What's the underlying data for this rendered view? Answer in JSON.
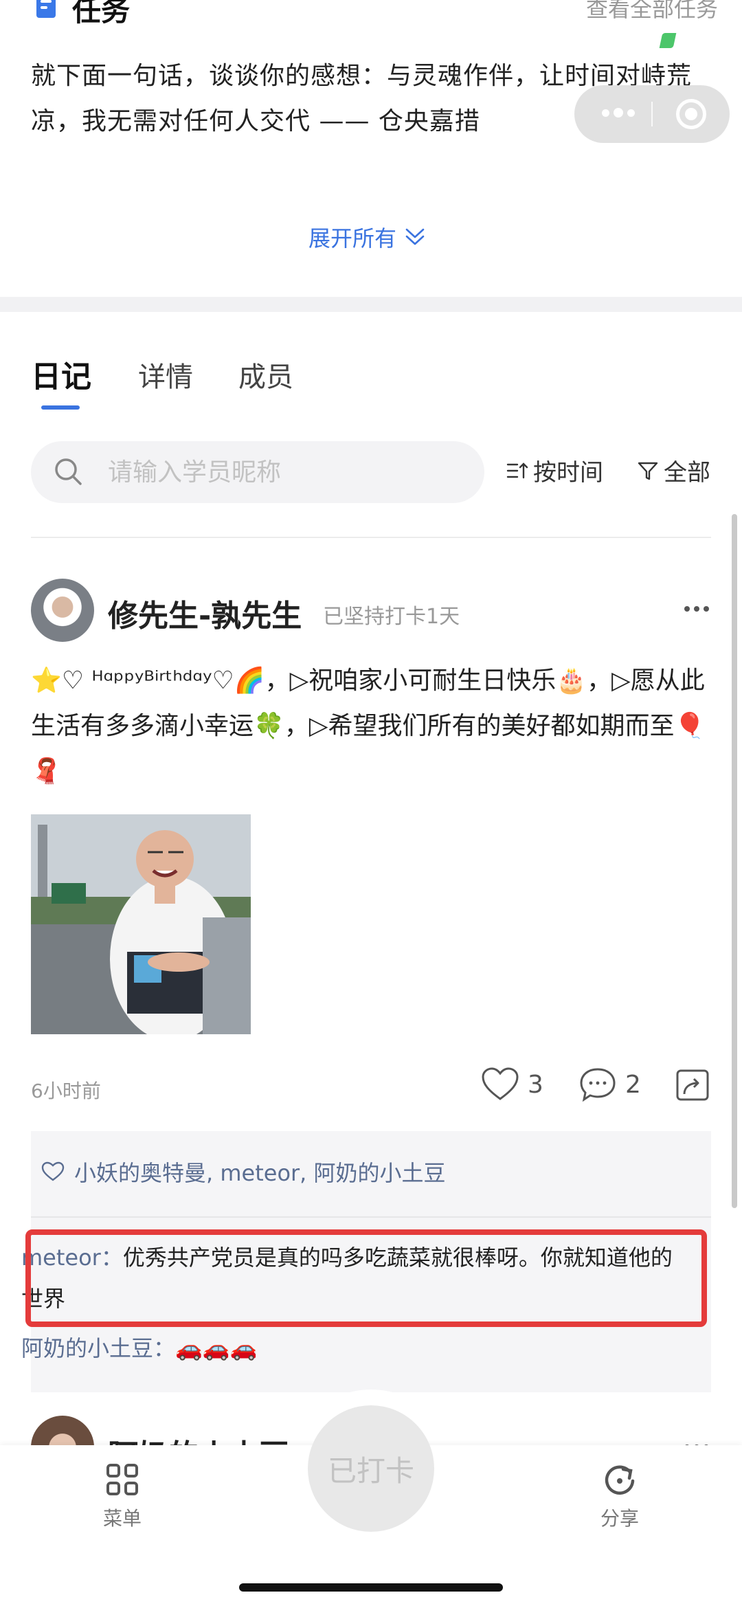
{
  "task_section": {
    "title": "任务",
    "view_all": "查看全部任务",
    "text": "就下面一句话，谈谈你的感想：与灵魂作伴，让时间对峙荒凉，我无需对任何人交代 —— 仓央嘉措",
    "expand_label": "展开所有"
  },
  "tabs": [
    {
      "label": "日记",
      "active": true
    },
    {
      "label": "详情",
      "active": false
    },
    {
      "label": "成员",
      "active": false
    }
  ],
  "search": {
    "placeholder": "请输入学员昵称",
    "sort_label": "按时间",
    "filter_label": "全部"
  },
  "post": {
    "username": "修先生-孰先生",
    "streak": "已坚持打卡1天",
    "text": "⭐♡ ᴴᵅᵖᵖʸᴮⁱʳᵗʰᵈᵅʸ♡🌈，▷祝咱家小可耐生日快乐🎂，▷愿从此生活有多多滴小幸运🍀，▷希望我们所有的美好都如期而至🎈🧣",
    "time": "6小时前",
    "like_count": "3",
    "comment_count": "2",
    "likers": "小妖的奥特曼, meteor, 阿奶的小土豆",
    "comments": [
      {
        "author": "meteor：",
        "text": "优秀共产党员是真的吗多吃蔬菜就很棒呀。你就知道他的世界"
      },
      {
        "author": "阿奶的小土豆：",
        "text": "🚗🚗🚗"
      }
    ]
  },
  "next_post": {
    "username": "阿奶的小土豆"
  },
  "bottom_nav": {
    "menu_label": "菜单",
    "checkin_label": "已打卡",
    "share_label": "分享"
  },
  "colors": {
    "accent": "#3a73e0",
    "link": "#5a6d91",
    "highlight": "#e43b3b"
  }
}
